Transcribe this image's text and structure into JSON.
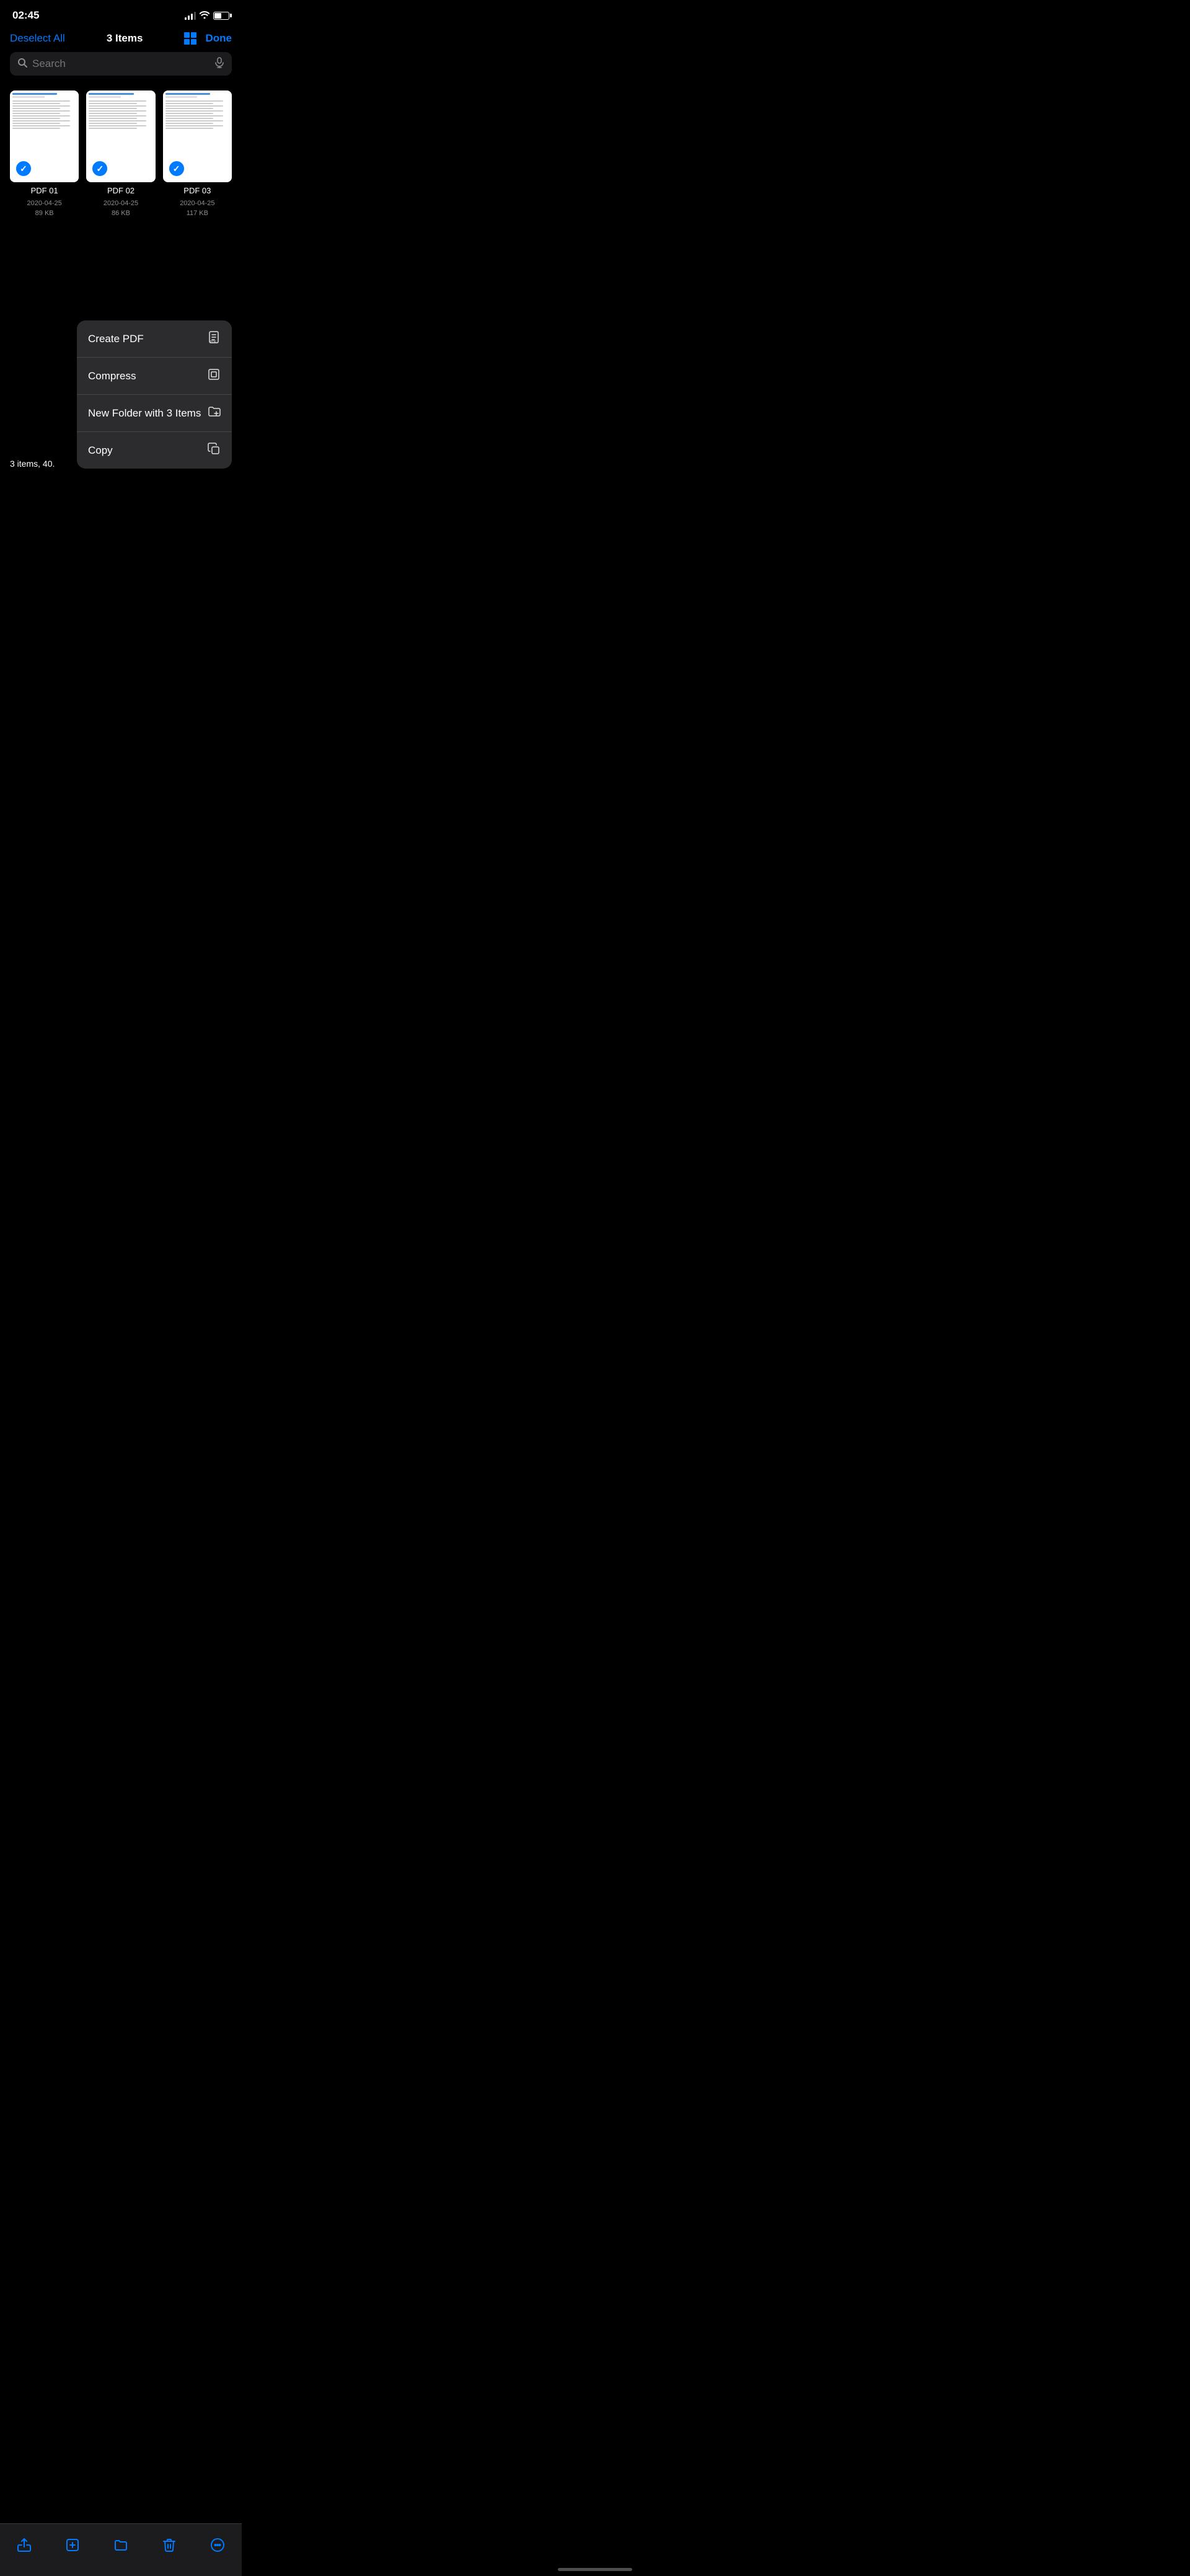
{
  "statusBar": {
    "time": "02:45",
    "batteryPercent": 50
  },
  "navBar": {
    "deselectLabel": "Deselect All",
    "titleLabel": "3 Items",
    "doneLabel": "Done"
  },
  "searchBar": {
    "placeholder": "Search"
  },
  "files": [
    {
      "name": "PDF 01",
      "date": "2020-04-25",
      "size": "89 KB"
    },
    {
      "name": "PDF 02",
      "date": "2020-04-25",
      "size": "86 KB"
    },
    {
      "name": "PDF 03",
      "date": "2020-04-25",
      "size": "117 KB"
    }
  ],
  "bottomStatus": {
    "text": "3 items, 40."
  },
  "contextMenu": {
    "items": [
      {
        "label": "Create PDF",
        "icon": "pdf"
      },
      {
        "label": "Compress",
        "icon": "compress"
      },
      {
        "label": "New Folder with 3 Items",
        "icon": "new-folder"
      },
      {
        "label": "Copy",
        "icon": "copy"
      }
    ]
  },
  "toolbar": {
    "buttons": [
      "share",
      "add",
      "folder",
      "trash",
      "more"
    ]
  }
}
